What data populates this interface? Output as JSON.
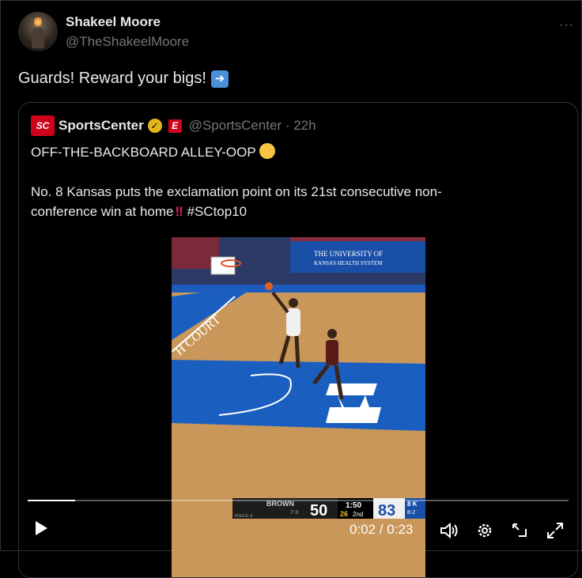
{
  "tweet": {
    "author_name": "Shakeel Moore",
    "author_handle": "@TheShakeelMoore",
    "text": "Guards! Reward your bigs!",
    "more_label": "···"
  },
  "quote": {
    "logo_text": "SC",
    "name": "SportsCenter",
    "badge_text": "E",
    "handle": "@SportsCenter · 22h",
    "line1": "OFF-THE-BACKBOARD ALLEY-OOP",
    "line2": "No. 8 Kansas puts the exclamation point on its 21st consecutive non-",
    "line3": "conference win at home",
    "hashtag": "#SCtop10"
  },
  "video": {
    "banner_line1": "THE UNIVERSITY OF",
    "banner_line2": "KANSAS HEALTH SYSTEM",
    "court_text": "H COURT",
    "scoreboard": {
      "away_team": "BROWN",
      "away_record": "7-3",
      "away_score": "50",
      "fouls": "FOULS: 6",
      "clock": "1:50",
      "shot_clock": "26",
      "period": "2nd",
      "home_score": "83",
      "home_rank": "8 K",
      "home_record": "8-2"
    },
    "progress": 0.087,
    "time": "0:02 / 0:23"
  },
  "colors": {
    "background": "#000000",
    "border": "#2f3336",
    "secondary_text": "#71767b",
    "espn_red": "#d0021b",
    "verified_gold": "#e2b719",
    "court_blue": "#1a5fc0"
  }
}
